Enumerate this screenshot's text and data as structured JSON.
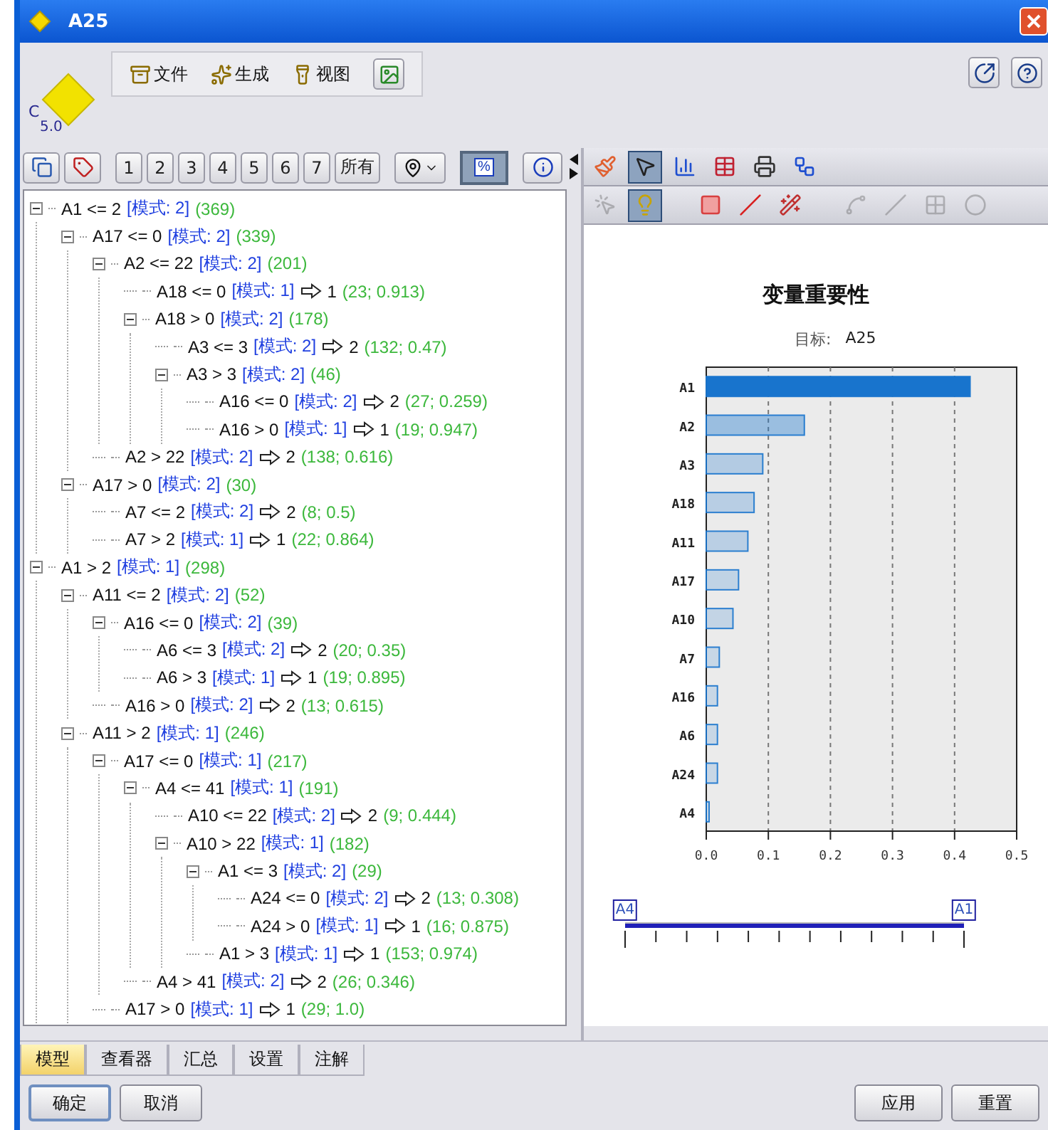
{
  "window": {
    "title": "A25"
  },
  "logo": {
    "letter": "C",
    "version": "5.0"
  },
  "menu": [
    {
      "kind": "file",
      "label": "文件"
    },
    {
      "kind": "generate",
      "label": "生成"
    },
    {
      "kind": "view",
      "label": "视图"
    }
  ],
  "tree_toolbar": {
    "levels": [
      {
        "label": "1"
      },
      {
        "label": "2"
      },
      {
        "label": "3"
      },
      {
        "label": "4"
      },
      {
        "label": "5"
      },
      {
        "label": "6"
      },
      {
        "label": "7"
      },
      {
        "label": "所有"
      }
    ],
    "percent": {
      "label": "%",
      "on": true
    }
  },
  "tree": [
    {
      "condition": "A1 <= 2",
      "mode": "[模式: 2]",
      "stats": "(369)",
      "expanded": true,
      "children": [
        {
          "condition": "A17 <= 0",
          "mode": "[模式: 2]",
          "stats": "(339)",
          "expanded": true,
          "children": [
            {
              "condition": "A2 <= 22",
              "mode": "[模式: 2]",
              "stats": "(201)",
              "expanded": true,
              "children": [
                {
                  "condition": "A18 <= 0",
                  "mode": "[模式: 1]",
                  "prediction": "1",
                  "stats": "(23; 0.913)"
                },
                {
                  "condition": "A18 > 0",
                  "mode": "[模式: 2]",
                  "stats": "(178)",
                  "expanded": true,
                  "children": [
                    {
                      "condition": "A3 <= 3",
                      "mode": "[模式: 2]",
                      "prediction": "2",
                      "stats": "(132; 0.47)"
                    },
                    {
                      "condition": "A3 > 3",
                      "mode": "[模式: 2]",
                      "stats": "(46)",
                      "expanded": true,
                      "children": [
                        {
                          "condition": "A16 <= 0",
                          "mode": "[模式: 2]",
                          "prediction": "2",
                          "stats": "(27; 0.259)"
                        },
                        {
                          "condition": "A16 > 0",
                          "mode": "[模式: 1]",
                          "prediction": "1",
                          "stats": "(19; 0.947)"
                        }
                      ]
                    }
                  ]
                }
              ]
            },
            {
              "condition": "A2 > 22",
              "mode": "[模式: 2]",
              "prediction": "2",
              "stats": "(138; 0.616)"
            }
          ]
        },
        {
          "condition": "A17 > 0",
          "mode": "[模式: 2]",
          "stats": "(30)",
          "expanded": true,
          "children": [
            {
              "condition": "A7 <= 2",
              "mode": "[模式: 2]",
              "prediction": "2",
              "stats": "(8; 0.5)"
            },
            {
              "condition": "A7 > 2",
              "mode": "[模式: 1]",
              "prediction": "1",
              "stats": "(22; 0.864)"
            }
          ]
        }
      ]
    },
    {
      "condition": "A1 > 2",
      "mode": "[模式: 1]",
      "stats": "(298)",
      "expanded": true,
      "children": [
        {
          "condition": "A11 <= 2",
          "mode": "[模式: 2]",
          "stats": "(52)",
          "expanded": true,
          "children": [
            {
              "condition": "A16 <= 0",
              "mode": "[模式: 2]",
              "stats": "(39)",
              "expanded": true,
              "children": [
                {
                  "condition": "A6 <= 3",
                  "mode": "[模式: 2]",
                  "prediction": "2",
                  "stats": "(20; 0.35)"
                },
                {
                  "condition": "A6 > 3",
                  "mode": "[模式: 1]",
                  "prediction": "1",
                  "stats": "(19; 0.895)"
                }
              ]
            },
            {
              "condition": "A16 > 0",
              "mode": "[模式: 2]",
              "prediction": "2",
              "stats": "(13; 0.615)"
            }
          ]
        },
        {
          "condition": "A11 > 2",
          "mode": "[模式: 1]",
          "stats": "(246)",
          "expanded": true,
          "children": [
            {
              "condition": "A17 <= 0",
              "mode": "[模式: 1]",
              "stats": "(217)",
              "expanded": true,
              "children": [
                {
                  "condition": "A4 <= 41",
                  "mode": "[模式: 1]",
                  "stats": "(191)",
                  "expanded": true,
                  "children": [
                    {
                      "condition": "A10 <= 22",
                      "mode": "[模式: 2]",
                      "prediction": "2",
                      "stats": "(9; 0.444)"
                    },
                    {
                      "condition": "A10 > 22",
                      "mode": "[模式: 1]",
                      "stats": "(182)",
                      "expanded": true,
                      "children": [
                        {
                          "condition": "A1 <= 3",
                          "mode": "[模式: 2]",
                          "stats": "(29)",
                          "expanded": true,
                          "children": [
                            {
                              "condition": "A24 <= 0",
                              "mode": "[模式: 2]",
                              "prediction": "2",
                              "stats": "(13; 0.308)"
                            },
                            {
                              "condition": "A24 > 0",
                              "mode": "[模式: 1]",
                              "prediction": "1",
                              "stats": "(16; 0.875)"
                            }
                          ]
                        },
                        {
                          "condition": "A1 > 3",
                          "mode": "[模式: 1]",
                          "prediction": "1",
                          "stats": "(153; 0.974)"
                        }
                      ]
                    }
                  ]
                },
                {
                  "condition": "A4 > 41",
                  "mode": "[模式: 2]",
                  "prediction": "2",
                  "stats": "(26; 0.346)"
                }
              ]
            },
            {
              "condition": "A17 > 0",
              "mode": "[模式: 1]",
              "prediction": "1",
              "stats": "(29; 1.0)"
            }
          ]
        }
      ]
    }
  ],
  "chart_tools": [
    {
      "kind": "brush",
      "selected": false,
      "disabled": false
    },
    {
      "kind": "pointer",
      "selected": true,
      "disabled": false
    },
    {
      "kind": "chart",
      "selected": false,
      "disabled": false
    },
    {
      "kind": "table",
      "selected": false,
      "disabled": false
    },
    {
      "kind": "print",
      "selected": false,
      "disabled": false
    },
    {
      "kind": "network",
      "selected": false,
      "disabled": false
    }
  ],
  "chart_tools_2": [
    {
      "kind": "cursor",
      "selected": false,
      "disabled": true
    },
    {
      "kind": "bulb",
      "selected": true,
      "disabled": false
    },
    {
      "kind": "square",
      "selected": false,
      "disabled": false
    },
    {
      "kind": "bar",
      "selected": false,
      "disabled": false
    },
    {
      "kind": "wand",
      "selected": false,
      "disabled": false
    },
    {
      "kind": "spline",
      "selected": false,
      "disabled": true
    },
    {
      "kind": "line",
      "selected": false,
      "disabled": true
    },
    {
      "kind": "grid",
      "selected": false,
      "disabled": true
    },
    {
      "kind": "ring",
      "selected": false,
      "disabled": true
    }
  ],
  "importance": {
    "target_label": "目标:",
    "target": "A25",
    "chart_data": {
      "type": "bar",
      "orientation": "horizontal",
      "title": "变量重要性",
      "categories": [
        "A1",
        "A2",
        "A3",
        "A18",
        "A11",
        "A17",
        "A10",
        "A7",
        "A16",
        "A6",
        "A24",
        "A4"
      ],
      "grid": true,
      "series": [
        {
          "color": "#1874cd",
          "values": [
            0.425,
            0.158,
            0.091,
            0.077,
            0.067,
            0.052,
            0.043,
            0.021,
            0.018,
            0.018,
            0.018,
            0.004
          ]
        }
      ],
      "xlim": [
        0,
        0.5
      ],
      "xticks": [
        {
          "value": 0,
          "label": "0.0"
        },
        {
          "value": 0.1,
          "label": "0.1"
        },
        {
          "value": 0.2,
          "label": "0.2"
        },
        {
          "value": 0.3,
          "label": "0.3"
        },
        {
          "value": 0.4,
          "label": "0.4"
        },
        {
          "value": 0.5,
          "label": "0.5"
        }
      ]
    },
    "range": [
      {
        "label": "A4",
        "level": 0
      },
      {
        "label": "A1",
        "level": 1
      }
    ]
  },
  "tabs": [
    {
      "label": "模型",
      "selected": true
    },
    {
      "label": "查看器",
      "selected": false
    },
    {
      "label": "汇总",
      "selected": false
    },
    {
      "label": "设置",
      "selected": false
    },
    {
      "label": "注解",
      "selected": false
    }
  ],
  "buttons_left": [
    {
      "label": "确定",
      "focused": true
    },
    {
      "label": "取消",
      "focused": false
    }
  ],
  "buttons_right": [
    {
      "label": "应用",
      "focused": false
    },
    {
      "label": "重置",
      "focused": false
    }
  ]
}
